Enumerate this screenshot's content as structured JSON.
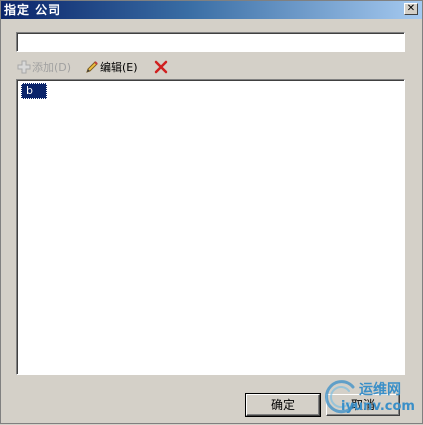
{
  "window": {
    "title": "指定 公司",
    "close_glyph": "✕"
  },
  "name_input": {
    "value": "",
    "placeholder": ""
  },
  "toolbar": {
    "add_label": "添加(D)",
    "edit_label": "编辑(E)",
    "delete_icon": "red-x-icon"
  },
  "list": {
    "items": [
      {
        "label": "b",
        "selected": true
      }
    ]
  },
  "buttons": {
    "ok_label": "确定",
    "cancel_label": "取消"
  },
  "watermark": {
    "line1": "运维网",
    "line2": "iyunv.com"
  },
  "colors": {
    "title_gradient_start": "#0a246a",
    "title_gradient_end": "#a6caf0",
    "selection": "#0a246a",
    "dialog_bg": "#d4d0c8",
    "watermark": "#3a8fc8"
  }
}
